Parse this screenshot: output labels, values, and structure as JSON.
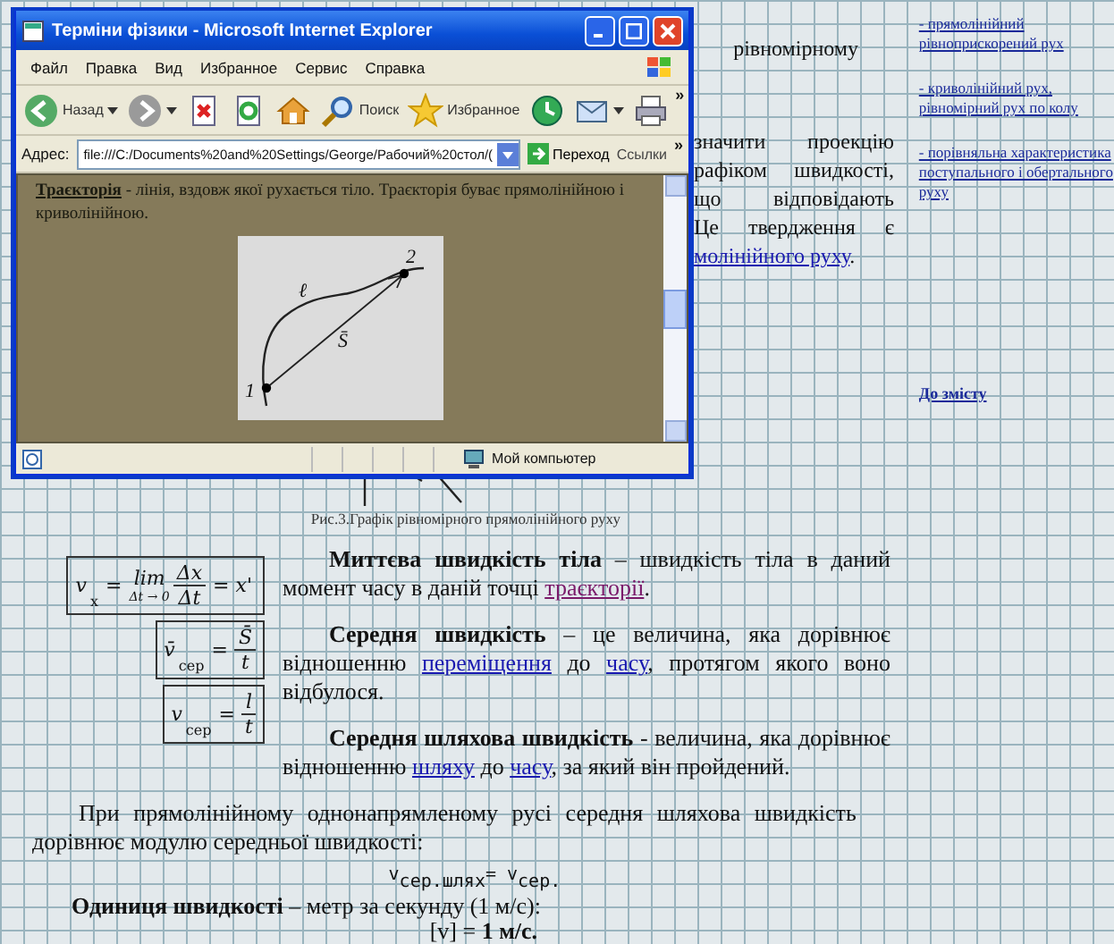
{
  "browser_window": {
    "title": "Терміни фізики - Microsoft Internet Explorer",
    "menu": [
      "Файл",
      "Правка",
      "Вид",
      "Избранное",
      "Сервис",
      "Справка"
    ],
    "toolbar": [
      {
        "kind": "back",
        "label": "Назад"
      },
      {
        "kind": "forward"
      },
      {
        "kind": "stop"
      },
      {
        "kind": "refresh"
      },
      {
        "kind": "home"
      },
      {
        "kind": "search",
        "label": "Поиск"
      },
      {
        "kind": "favorites",
        "label": "Избранное"
      },
      {
        "kind": "history"
      },
      {
        "kind": "mail"
      },
      {
        "kind": "print"
      }
    ],
    "toolbar_more": "»",
    "address_label": "Адрес:",
    "address": "file:///C:/Documents%20and%20Settings/George/Рабочий%20стол/(",
    "go_label": "Переход",
    "links_label": "Ссылки",
    "links_more": "»",
    "content": {
      "term": "Траєкторія",
      "definition": " - лінія, вздовж якої рухається тіло. Траєкторія буває прямолінійною і криволінійною.",
      "figure_labels": {
        "path": "ℓ",
        "displacement": "S̄",
        "start": "1",
        "end": "2"
      }
    },
    "status": "Мой компьютер"
  },
  "behind_window": {
    "heading_fragment": "рівномірному",
    "paragraph_fragments": [
      "значити проекцію",
      "рафіком швидкості,",
      "що відповідають",
      "Це твердження є"
    ],
    "link_fragment": "молінійного руху",
    "after_link": "."
  },
  "sidebar": {
    "links": [
      "- прямолінійний рівноприскорений рух",
      "- криволінійний рух, рівномірний рух по колу",
      "- порівняльна характеристика поступального і обертального руху"
    ],
    "contents_link": "До змісту"
  },
  "caption": "Рис.3.Графік рівномірного прямолінійного руху",
  "formulas": [
    {
      "lhs": "v",
      "lhs_sub": "x",
      "eq": "=",
      "limit": {
        "op": "lim",
        "under": "Δt → 0"
      },
      "num": "Δx",
      "den": "Δt",
      "tail": "= x'"
    },
    {
      "lhs": "v̄",
      "lhs_sub": "сер",
      "eq": "=",
      "num": "S̄",
      "den": "t"
    },
    {
      "lhs": "v",
      "lhs_sub": "сер",
      "eq": "=",
      "num": "l",
      "den": "t"
    }
  ],
  "definitions": [
    [
      {
        "kind": "term",
        "text": "Миттєва швидкість тіла"
      },
      {
        "kind": "text",
        "text": " – швидкість тіла в даний момент часу в даній точці "
      },
      {
        "kind": "link",
        "text": "траєкторії",
        "visited": true
      },
      {
        "kind": "text",
        "text": "."
      }
    ],
    [
      {
        "kind": "term",
        "text": "Середня швидкість"
      },
      {
        "kind": "text",
        "text": " – це величина, яка дорівнює відношенню "
      },
      {
        "kind": "link",
        "text": "переміщення",
        "visited": false
      },
      {
        "kind": "text",
        "text": " до "
      },
      {
        "kind": "link",
        "text": "часу",
        "visited": false
      },
      {
        "kind": "text",
        "text": ", протягом якого воно відбулося."
      }
    ],
    [
      {
        "kind": "term",
        "text": "Середня шляхова швидкість"
      },
      {
        "kind": "text",
        "text": " - величина, яка дорівнює відношенню "
      },
      {
        "kind": "link",
        "text": "шляху",
        "visited": false
      },
      {
        "kind": "text",
        "text": " до "
      },
      {
        "kind": "link",
        "text": "часу",
        "visited": false
      },
      {
        "kind": "text",
        "text": ", за який він пройдений."
      }
    ]
  ],
  "paragraph": "При прямолінійному однонапрямленому русі середня шляхова швидкість дорівнює модулю середньої швидкості:",
  "path_speed_formula": {
    "lhs": "v",
    "lhs_sub": "сер.шлях",
    "eq": "= v",
    "rhs_sub": "сер."
  },
  "unit": {
    "term": "Одиниця швидкості",
    "text": " – метр за секунду (1 м/с):",
    "formula": "[v] = **1 м/с.**"
  }
}
